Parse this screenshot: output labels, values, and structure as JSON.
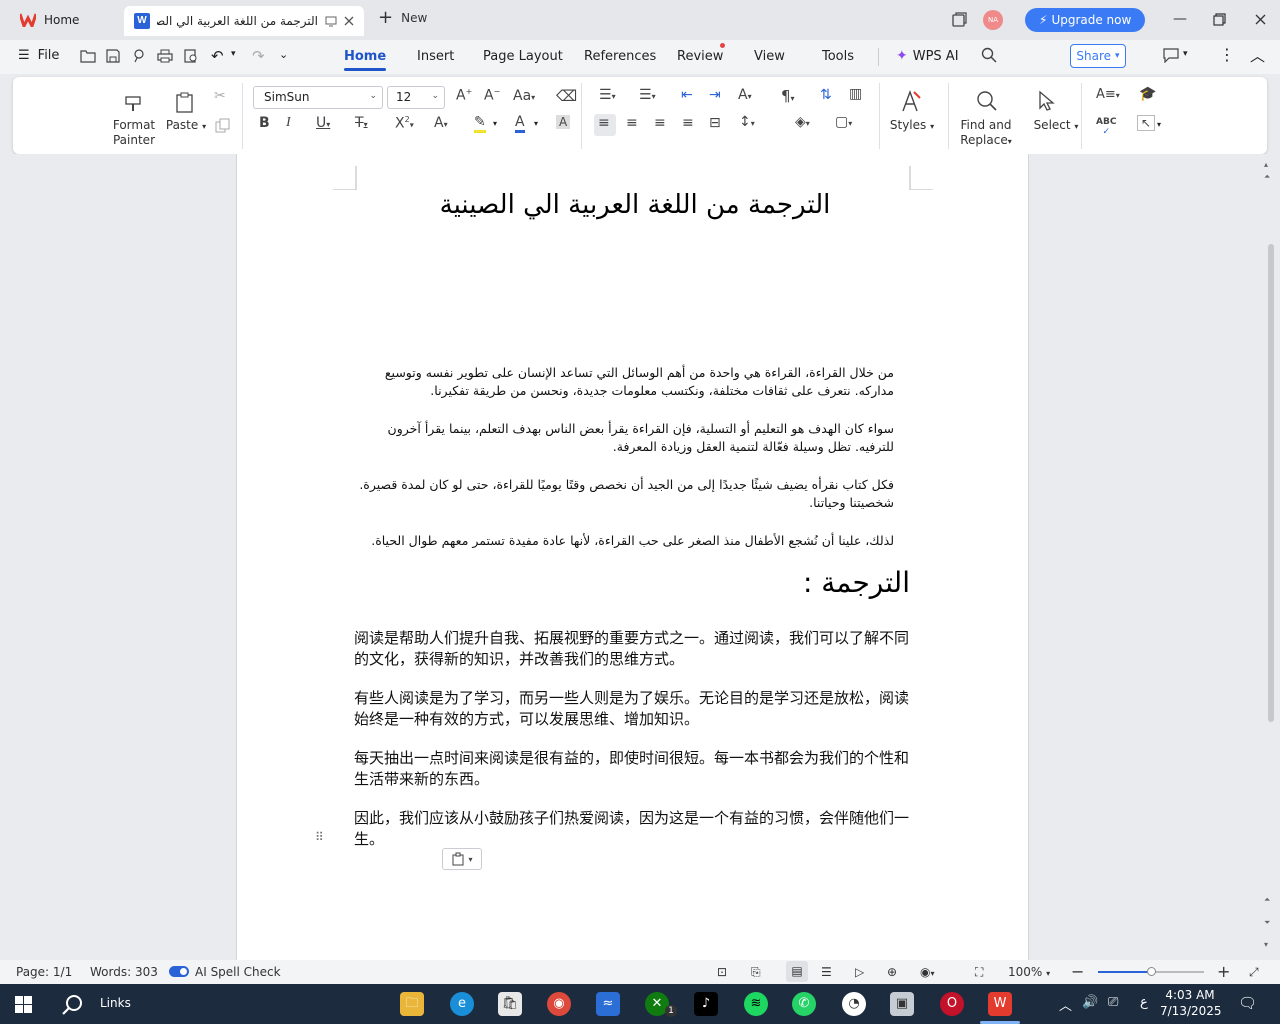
{
  "tabs": {
    "home_label": "Home",
    "doc_title": "الترجمة من اللغة العربية الي الصينية",
    "new_label": "New"
  },
  "topbar": {
    "avatar_initials": "NA",
    "upgrade_label": "Upgrade now"
  },
  "menu": {
    "file": "File",
    "tabs": [
      "Home",
      "Insert",
      "Page Layout",
      "References",
      "Review",
      "View",
      "Tools"
    ],
    "wps_ai": "WPS AI",
    "share": "Share"
  },
  "ribbon": {
    "format_painter_1": "Format",
    "format_painter_2": "Painter",
    "paste": "Paste",
    "font_name": "SimSun",
    "font_size": "12",
    "styles": "Styles",
    "find_1": "Find and",
    "find_2": "Replace",
    "select": "Select"
  },
  "document": {
    "title": "الترجمة من اللغة العربية الي الصينية",
    "arabic_paragraphs": [
      "من خلال القراءة، القراءة هي واحدة من أهم الوسائل التي تساعد الإنسان على تطوير نفسه وتوسيع مداركه. نتعرف على ثقافات مختلفة، ونكتسب معلومات جديدة، ونحسن من طريقة تفكيرنا.",
      "سواء كان الهدف هو التعليم أو التسلية، فإن القراءة يقرأ بعض الناس بهدف التعلم، بينما يقرأ آخرون للترفيه. تظل وسيلة فعّالة لتنمية العقل وزيادة المعرفة.",
      "فكل كتاب نقرأه يضيف شيئًا جديدًا إلى من الجيد أن نخصص وقتًا يوميًا للقراءة، حتى لو كان لمدة قصيرة. شخصيتنا وحياتنا.",
      "لذلك، علينا أن نُشجع الأطفال منذ الصغر على حب القراءة، لأنها عادة مفيدة تستمر معهم طوال الحياة."
    ],
    "translation_heading": "الترجمة :",
    "chinese_paragraphs": [
      "阅读是帮助人们提升自我、拓展视野的重要方式之一。通过阅读，我们可以了解不同的文化，获得新的知识，并改善我们的思维方式。",
      "有些人阅读是为了学习，而另一些人则是为了娱乐。无论目的是学习还是放松，阅读始终是一种有效的方式，可以发展思维、增加知识。",
      "每天抽出一点时间来阅读是很有益的，即使时间很短。每一本书都会为我们的个性和生活带来新的东西。",
      "因此，我们应该从小鼓励孩子们热爱阅读，因为这是一个有益的习惯，会伴随他们一生。"
    ]
  },
  "status": {
    "page": "Page: 1/1",
    "words": "Words: 303",
    "spell": "AI Spell Check",
    "zoom": "100%",
    "zoom_fraction": 0.5
  },
  "taskbar": {
    "search_label": "Links",
    "lang": "ع",
    "time": "4:03 AM",
    "date": "7/13/2025",
    "xbox_badge": "1"
  },
  "colors": {
    "accent": "#1e55c9",
    "upgrade": "#3a7bf5",
    "taskbar": "#1c2b3d"
  }
}
